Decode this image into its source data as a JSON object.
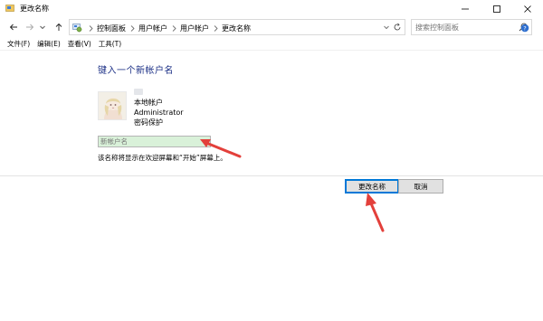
{
  "window": {
    "title": "更改名称"
  },
  "address": {
    "breadcrumbs": [
      "控制面板",
      "用户帐户",
      "用户帐户",
      "更改名称"
    ]
  },
  "search": {
    "placeholder": "搜索控制面板"
  },
  "menu": [
    "文件(F)",
    "编辑(E)",
    "查看(V)",
    "工具(T)"
  ],
  "main": {
    "heading": "键入一个新帐户名",
    "account": {
      "type": "本地帐户",
      "name": "Administrator",
      "password_status": "密码保护"
    },
    "new_name_placeholder": "新帐户名",
    "hint": "该名称将显示在欢迎屏幕和“开始”屏幕上。"
  },
  "buttons": {
    "rename": "更改名称",
    "cancel": "取消"
  },
  "icons": [
    "app-icon",
    "minimize-icon",
    "maximize-icon",
    "close-icon",
    "back-arrow-icon",
    "forward-arrow-icon",
    "recent-dropdown-icon",
    "up-arrow-icon",
    "control-panel-icon",
    "chevron-right-icon",
    "chevron-down-icon",
    "refresh-icon",
    "search-icon",
    "help-icon",
    "user-avatar",
    "annotation-arrow"
  ],
  "colors": {
    "heading": "#1e3287",
    "input_highlight": "#d9f1d9",
    "annotation_arrow": "#e3403b",
    "button_focus": "#0078d7"
  }
}
